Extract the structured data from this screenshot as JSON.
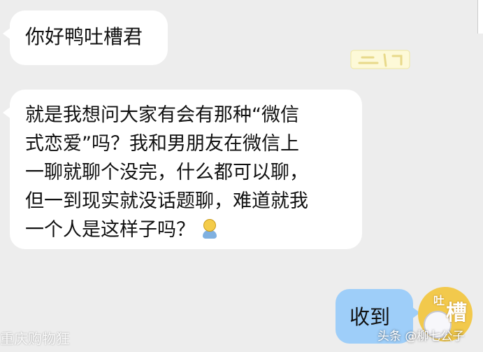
{
  "chat": {
    "messages": [
      {
        "sender": "other",
        "text": "你好鸭吐槽君"
      },
      {
        "sender": "other",
        "text": "就是我想问大家有会有那种“微信\n式恋爱”吗？我和男朋友在微信上\n一聊就聊个没完，什么都可以聊，\n但一到现实就没话题聊，难道就我\n一个人是这样子吗？"
      },
      {
        "sender": "self",
        "text": "收到"
      }
    ]
  },
  "avatar": {
    "label_small": "吐",
    "label_big": "槽"
  },
  "icons": {
    "emoji": "shy-emoji-icon",
    "sticker": "sticker-icon"
  },
  "watermarks": {
    "left": "重庆购物狂",
    "right": "头条 @柳七公子"
  },
  "colors": {
    "background": "#ededed",
    "incoming_bubble": "#ffffff",
    "outgoing_bubble": "#9ecef9",
    "avatar": "#f2c94c"
  }
}
